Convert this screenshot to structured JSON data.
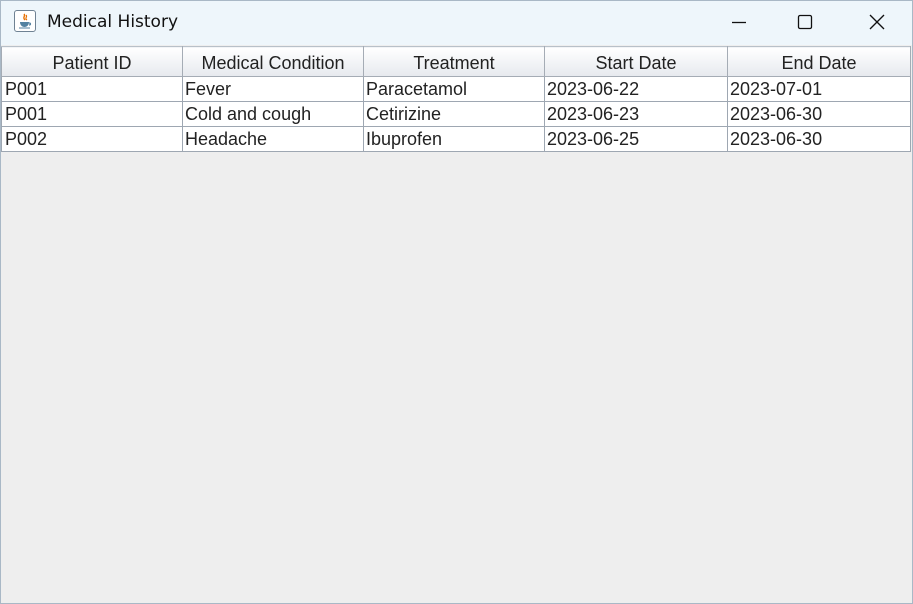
{
  "window": {
    "title": "Medical History",
    "icon": "java-cup-icon"
  },
  "title_buttons": {
    "minimize_icon": "minimize-icon",
    "maximize_icon": "maximize-icon",
    "close_icon": "close-icon"
  },
  "table": {
    "columns": [
      "Patient ID",
      "Medical Condition",
      "Treatment",
      "Start Date",
      "End Date"
    ],
    "rows": [
      [
        "P001",
        "Fever",
        "Paracetamol",
        "2023-06-22",
        "2023-07-01"
      ],
      [
        "P001",
        "Cold and cough",
        "Cetirizine",
        "2023-06-23",
        "2023-06-30"
      ],
      [
        "P002",
        "Headache",
        "Ibuprofen",
        "2023-06-25",
        "2023-06-30"
      ]
    ]
  }
}
